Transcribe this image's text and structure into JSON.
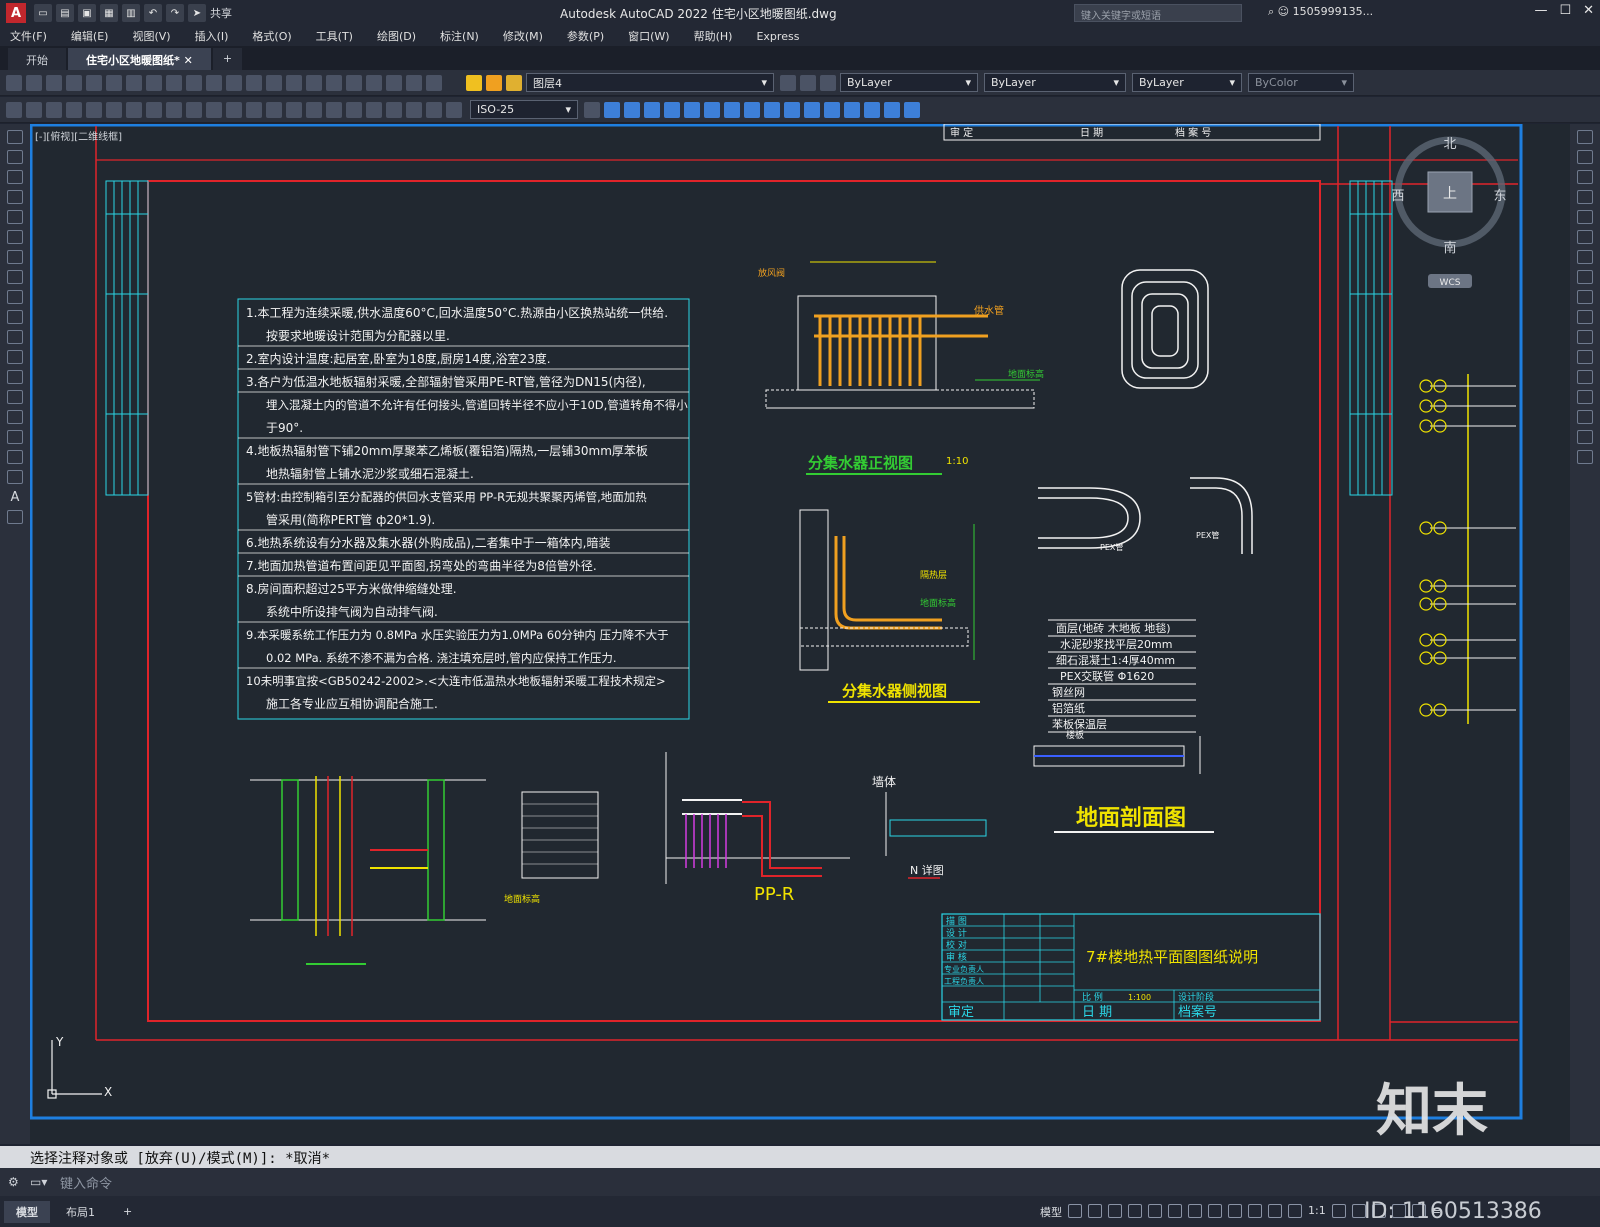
{
  "app": {
    "logo_letter": "A",
    "title": "Autodesk AutoCAD 2022    住宅小区地暖图纸.dwg",
    "search_placeholder": "键入关键字或短语",
    "share_label": "共享",
    "user": "1505999135..."
  },
  "menu": [
    "文件(F)",
    "编辑(E)",
    "视图(V)",
    "插入(I)",
    "格式(O)",
    "工具(T)",
    "绘图(D)",
    "标注(N)",
    "修改(M)",
    "参数(P)",
    "窗口(W)",
    "帮助(H)",
    "Express"
  ],
  "tabs": [
    {
      "label": "开始",
      "active": false
    },
    {
      "label": "住宅小区地暖图纸*",
      "active": true
    }
  ],
  "toolbar": {
    "layer": "图层4",
    "color": "ByLayer",
    "linetype": "ByLayer",
    "lineweight": "ByLayer",
    "plotstyle": "ByColor",
    "dimstyle": "ISO-25"
  },
  "viewport_label": "[-][俯视][二维线框]",
  "viewcube": {
    "north": "北",
    "south": "南",
    "east": "东",
    "west": "西",
    "top": "上",
    "wcs": "WCS"
  },
  "notes": [
    "1.本工程为连续采暖,供水温度60°C,回水温度50°C.热源由小区换热站统一供给.",
    "按要求地暖设计范围为分配器以里.",
    "2.室内设计温度:起居室,卧室为18度,厨房14度,浴室23度.",
    "3.各户为低温水地板辐射采暖,全部辐射管采用PE-RT管,管径为DN15(内径),",
    "埋入混凝土内的管道不允许有任何接头,管道回转半径不应小于10D,管道转角不得小",
    "于90°.",
    "4.地板热辐射管下铺20mm厚聚苯乙烯板(覆铝箔)隔热,一层铺30mm厚苯板",
    "地热辐射管上铺水泥沙浆或细石混凝土.",
    "5管材:由控制箱引至分配器的供回水支管采用 PP-R无规共聚聚丙烯管,地面加热",
    "管采用(简称PERT管 ф20*1.9).",
    "6.地热系统设有分水器及集水器(外购成品),二者集中于一箱体内,暗装",
    "7.地面加热管道布置间距见平面图,拐弯处的弯曲半径为8倍管外径.",
    "8.房间面积超过25平方米做伸缩缝处理.",
    "系统中所设排气阀为自动排气阀.",
    "9.本采暖系统工作压力为 0.8MPa 水压实验压力为1.0MPa 60分钟内 压力降不大于",
    "0.02 MPa. 系统不渗不漏为合格. 浇注填充层时,管内应保持工作压力.",
    "10未明事宜按<GB50242-2002>.<大连市低温热水地板辐射采暖工程技术规定>",
    "施工各专业应互相协调配合施工."
  ],
  "drawing": {
    "front_view_title": "分集水器正视图",
    "front_view_scale": "1:10",
    "side_view_title": "分集水器侧视图",
    "supply_label": "供水管",
    "vent_label": "放风阀",
    "floor_level": "地面标高",
    "insulation": "隔热层",
    "pex_label": "PEX管",
    "ppr_label": "PP-R",
    "wall_label": "墙体",
    "detail_label": "N 详图",
    "section_title": "地面剖面图",
    "layers": [
      "面层(地砖 木地板 地毯)",
      "水泥砂浆找平层20mm",
      "细石混凝土1:4厚40mm",
      "PEX交联管 Φ1620",
      "钢丝网",
      "铝箔纸",
      "苯板保温层",
      "楼板"
    ]
  },
  "title_block": {
    "rows": [
      "描 图",
      "设 计",
      "校 对",
      "审 核",
      "专业负责人",
      "工程负责人"
    ],
    "drawing_name": "7#楼地热平面图图纸说明",
    "scale_label": "比 例",
    "scale_value": "1:100",
    "stage_label": "设计阶段",
    "review": "审定",
    "date": "日 期",
    "archive": "档案号"
  },
  "top_strip": {
    "review": "审 定",
    "date": "日 期",
    "archive": "档 案 号"
  },
  "command": {
    "history": "选择注释对象或 [放弃(U)/模式(M)]: *取消*",
    "prompt": "键入命令"
  },
  "status": {
    "layouts": [
      {
        "label": "模型",
        "active": true
      },
      {
        "label": "布局1",
        "active": false
      }
    ],
    "model_label": "模型",
    "scale": "1:1"
  },
  "watermark": {
    "brand": "知末",
    "id": "ID: 1160513386"
  },
  "colors": {
    "red": "#e0242a",
    "cyan": "#2bd6e6",
    "yellow": "#f0e300",
    "green": "#33cc33",
    "orange": "#f0a020",
    "magenta": "#d23ce0",
    "white": "#f2f2f2",
    "blue_frame": "#1e7fe0"
  }
}
